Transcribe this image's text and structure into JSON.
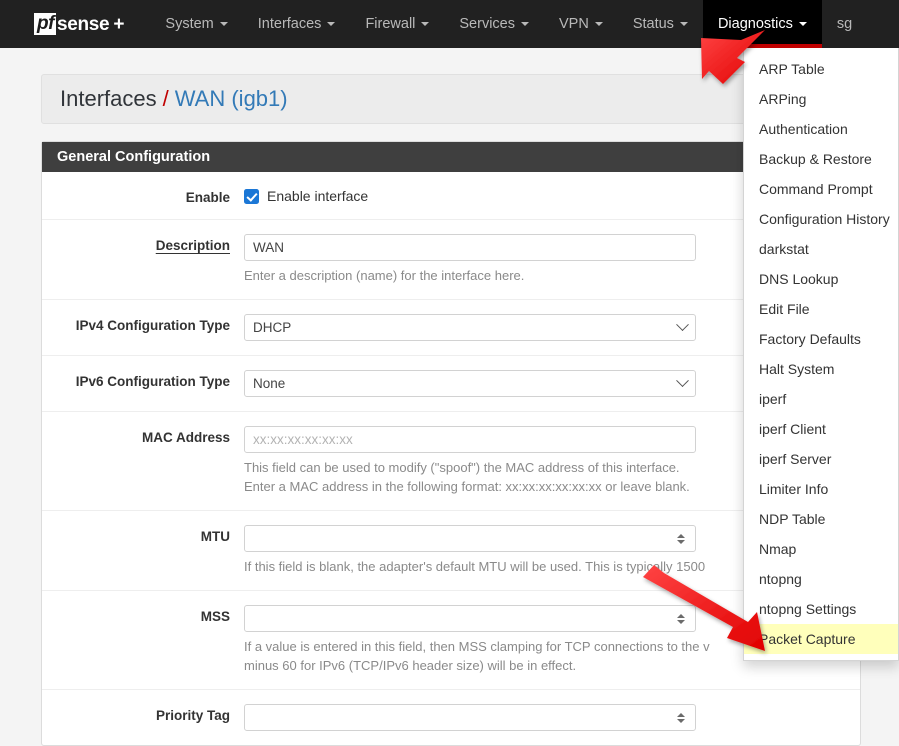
{
  "navbar": {
    "brand": {
      "pf": "pf",
      "sense": "sense",
      "plus": "+"
    },
    "items": [
      {
        "label": "System",
        "caret": true,
        "active": false
      },
      {
        "label": "Interfaces",
        "caret": true,
        "active": false
      },
      {
        "label": "Firewall",
        "caret": true,
        "active": false
      },
      {
        "label": "Services",
        "caret": true,
        "active": false
      },
      {
        "label": "VPN",
        "caret": true,
        "active": false
      },
      {
        "label": "Status",
        "caret": true,
        "active": false
      },
      {
        "label": "Diagnostics",
        "caret": true,
        "active": true
      }
    ],
    "user_text": "sg",
    "active_underline_color": "#c00000"
  },
  "dropdown": {
    "owner": "Diagnostics",
    "highlight_color": "#ffffbb",
    "items": [
      {
        "label": "ARP Table",
        "highlighted": false
      },
      {
        "label": "ARPing",
        "highlighted": false
      },
      {
        "label": "Authentication",
        "highlighted": false
      },
      {
        "label": "Backup & Restore",
        "highlighted": false
      },
      {
        "label": "Command Prompt",
        "highlighted": false
      },
      {
        "label": "Configuration History",
        "highlighted": false
      },
      {
        "label": "darkstat",
        "highlighted": false
      },
      {
        "label": "DNS Lookup",
        "highlighted": false
      },
      {
        "label": "Edit File",
        "highlighted": false
      },
      {
        "label": "Factory Defaults",
        "highlighted": false
      },
      {
        "label": "Halt System",
        "highlighted": false
      },
      {
        "label": "iperf",
        "highlighted": false
      },
      {
        "label": "iperf Client",
        "highlighted": false
      },
      {
        "label": "iperf Server",
        "highlighted": false
      },
      {
        "label": "Limiter Info",
        "highlighted": false
      },
      {
        "label": "NDP Table",
        "highlighted": false
      },
      {
        "label": "Nmap",
        "highlighted": false
      },
      {
        "label": "ntopng",
        "highlighted": false
      },
      {
        "label": "ntopng Settings",
        "highlighted": false
      },
      {
        "label": "Packet Capture",
        "highlighted": true
      }
    ]
  },
  "breadcrumb": {
    "parent": "Interfaces",
    "separator": "/",
    "current": "WAN (igb1)",
    "link_color": "#337ab7",
    "separator_color": "#c00000"
  },
  "panel": {
    "heading": "General Configuration",
    "rows": {
      "enable": {
        "label": "Enable",
        "checkbox_label": "Enable interface",
        "checked": true,
        "checkbox_color": "#1b77d6"
      },
      "description": {
        "label": "Description",
        "value": "WAN",
        "help": "Enter a description (name) for the interface here."
      },
      "ipv4_config": {
        "label": "IPv4 Configuration Type",
        "value": "DHCP"
      },
      "ipv6_config": {
        "label": "IPv6 Configuration Type",
        "value": "None"
      },
      "mac_address": {
        "label": "MAC Address",
        "placeholder": "xx:xx:xx:xx:xx:xx",
        "value": "",
        "help_line1": "This field can be used to modify (\"spoof\") the MAC address of this interface.",
        "help_line2": "Enter a MAC address in the following format: xx:xx:xx:xx:xx:xx or leave blank."
      },
      "mtu": {
        "label": "MTU",
        "value": "",
        "help": "If this field is blank, the adapter's default MTU will be used. This is typically 1500"
      },
      "mss": {
        "label": "MSS",
        "value": "",
        "help_line1": "If a value is entered in this field, then MSS clamping for TCP connections to the v",
        "help_line2": "minus 60 for IPv6 (TCP/IPv6 header size) will be in effect."
      },
      "priority_tag": {
        "label": "Priority Tag",
        "value": ""
      }
    }
  },
  "annotations": {
    "arrow_color": "#f01c1c",
    "arrow1_target": "Diagnostics",
    "arrow2_target": "Packet Capture"
  }
}
